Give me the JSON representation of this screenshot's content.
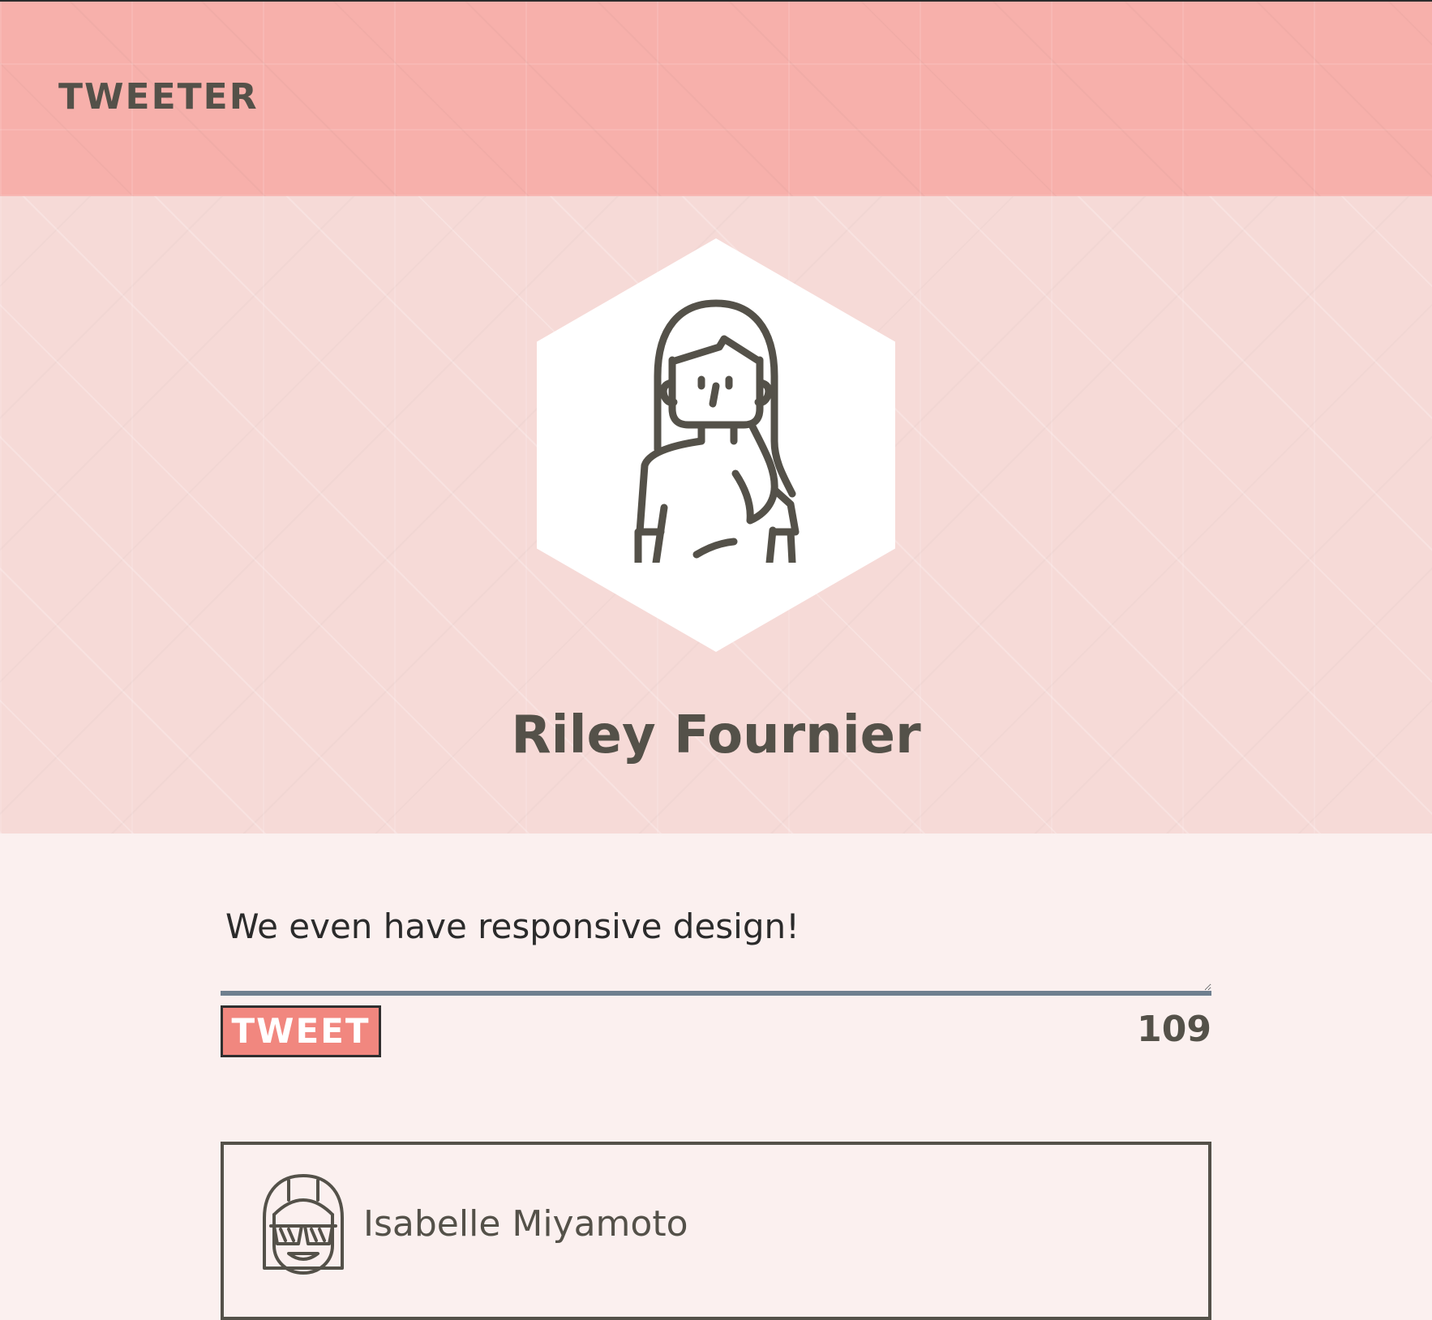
{
  "header": {
    "brand": "TWEETER"
  },
  "profile": {
    "name": "Riley Fournier",
    "avatar_icon": "person-long-hair-avatar-icon"
  },
  "compose": {
    "text": "We even have responsive design!",
    "tweet_label": "TWEET",
    "remaining_chars": "109"
  },
  "feed": {
    "tweets": [
      {
        "author": "Isabelle Miyamoto",
        "avatar_icon": "person-sunglasses-avatar-icon"
      }
    ]
  },
  "colors": {
    "header_bg": "#f7b0ab",
    "profile_bg": "#f6dad7",
    "page_bg": "#fbf0ef",
    "accent": "#f1877f",
    "text": "#545149",
    "underline": "#6f7f8f"
  }
}
